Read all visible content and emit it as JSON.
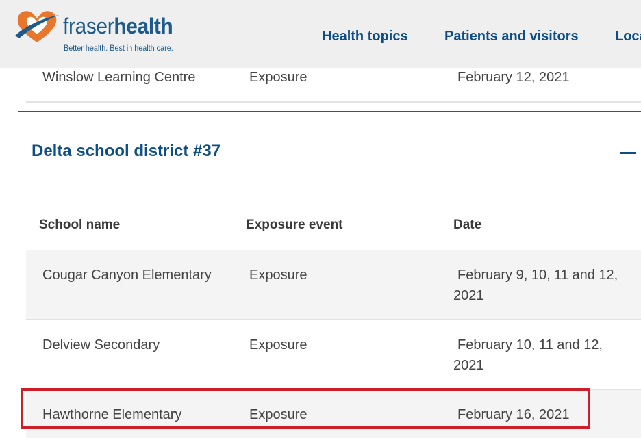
{
  "header": {
    "logo": {
      "word_light": "fraser",
      "word_bold": "health",
      "tagline": "Better health. Best in health care."
    },
    "nav": [
      {
        "label": "Health topics"
      },
      {
        "label": "Patients and visitors"
      },
      {
        "label": "Loca"
      }
    ]
  },
  "prev_section_last_row": {
    "school": "Winslow Learning Centre",
    "event": "Exposure",
    "date": "February 12, 2021"
  },
  "section": {
    "title": "Delta school district #37",
    "toggle_icon": "minus-icon",
    "columns": {
      "school": "School name",
      "event": "Exposure event",
      "date": "Date"
    },
    "rows": [
      {
        "school": "Cougar Canyon Elementary",
        "event": "Exposure",
        "date": "February 9, 10, 11 and 12, 2021"
      },
      {
        "school": "Delview Secondary",
        "event": "Exposure",
        "date": "February 10, 11 and 12, 2021"
      },
      {
        "school": "Hawthorne Elementary",
        "event": "Exposure",
        "date": "February 16, 2021"
      }
    ]
  },
  "colors": {
    "brand_blue": "#0d4e86",
    "logo_orange": "#e8772e",
    "highlight_red": "#cc1f2a",
    "header_bg": "#efefef",
    "shaded_row": "#f4f4f4"
  }
}
